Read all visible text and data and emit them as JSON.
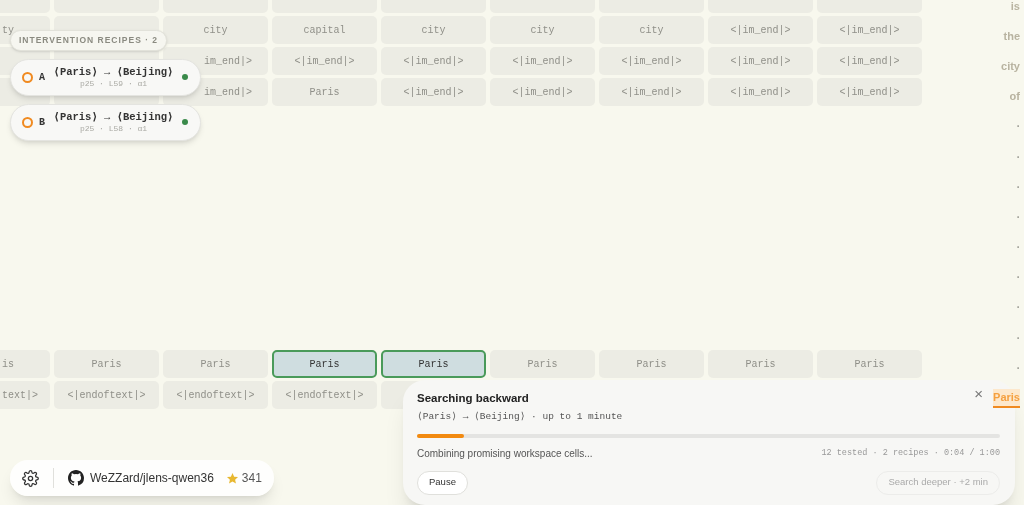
{
  "grid": {
    "row_groups": [
      {
        "rows": [
          {
            "cells": [
              {},
              {},
              {},
              {},
              {},
              {},
              {},
              {},
              {}
            ]
          },
          {
            "cells": [
              {
                "text": "ty"
              },
              {},
              {
                "text": "city"
              },
              {
                "text": "capital"
              },
              {
                "text": "city"
              },
              {
                "text": "city"
              },
              {
                "text": "city"
              },
              {
                "text": "<|im_end|>"
              },
              {
                "text": "<|im_end|>"
              }
            ]
          },
          {
            "cells": [
              {},
              {},
              {
                "text": "im_end|>"
              },
              {
                "text": "<|im_end|>"
              },
              {
                "text": "<|im_end|>"
              },
              {
                "text": "<|im_end|>"
              },
              {
                "text": "<|im_end|>"
              },
              {
                "text": "<|im_end|>"
              },
              {
                "text": "<|im_end|>"
              }
            ]
          },
          {
            "cells": [
              {},
              {},
              {
                "text": "im_end|>"
              },
              {
                "text": "Paris"
              },
              {
                "text": "<|im_end|>"
              },
              {
                "text": "<|im_end|>"
              },
              {
                "text": "<|im_end|>"
              },
              {
                "text": "<|im_end|>"
              },
              {
                "text": "<|im_end|>"
              }
            ]
          }
        ]
      },
      {
        "rows": [
          {
            "cells": [
              {
                "text": "is",
                "selected": false
              },
              {
                "text": "Paris",
                "selected": false
              },
              {
                "text": "Paris",
                "selected": false
              },
              {
                "text": "Paris",
                "selected": true
              },
              {
                "text": "Paris",
                "selected": true
              },
              {
                "text": "Paris",
                "selected": false
              },
              {
                "text": "Paris",
                "selected": false
              },
              {
                "text": "Paris",
                "selected": false
              },
              {
                "text": "Paris",
                "selected": false
              }
            ]
          },
          {
            "cells": [
              {
                "text": "text|>"
              },
              {
                "text": "<|endoftext|>"
              },
              {
                "text": "<|endoftext|>"
              },
              {
                "text": "<|endoftext|>"
              },
              {},
              {},
              {},
              {},
              {}
            ]
          }
        ]
      }
    ]
  },
  "tokens": [
    {
      "text": "is",
      "kind": "word"
    },
    {
      "text": "the",
      "kind": "word"
    },
    {
      "text": "city",
      "kind": "word"
    },
    {
      "text": "of",
      "kind": "word"
    },
    {
      "text": "·",
      "kind": "dot"
    },
    {
      "text": "·",
      "kind": "dot"
    },
    {
      "text": "·",
      "kind": "dot"
    },
    {
      "text": "·",
      "kind": "dot"
    },
    {
      "text": "·",
      "kind": "dot"
    },
    {
      "text": "·",
      "kind": "dot"
    },
    {
      "text": "·",
      "kind": "dot"
    },
    {
      "text": "·",
      "kind": "dot"
    },
    {
      "text": "·",
      "kind": "dot"
    },
    {
      "text": "Paris",
      "kind": "target"
    }
  ],
  "recipes": {
    "label": "INTERVENTION RECIPES · 2",
    "items": [
      {
        "letter": "A",
        "title": "⟨Paris⟩ → ⟨Beijing⟩",
        "meta": "p25 · L59 · α1",
        "color": "#3a8a4a"
      },
      {
        "letter": "B",
        "title": "⟨Paris⟩ → ⟨Beijing⟩",
        "meta": "p25 · L58 · α1",
        "color": "#3a8a4a"
      }
    ]
  },
  "footer": {
    "repo": "WeZZard/jlens-qwen36",
    "stars": "341"
  },
  "search_panel": {
    "title": "Searching backward",
    "subtitle": "⟨Paris⟩ → ⟨Beijing⟩ · up to 1 minute",
    "close": "×",
    "level": 0.08,
    "status": "Combining promising workspace cells...",
    "stats": "12 tested · 2 recipes · 0:04 / 1:00",
    "buttons": [
      {
        "label": "Pause",
        "disabled": false
      },
      {
        "label": "Search deeper · +2 min",
        "disabled": true
      }
    ]
  }
}
